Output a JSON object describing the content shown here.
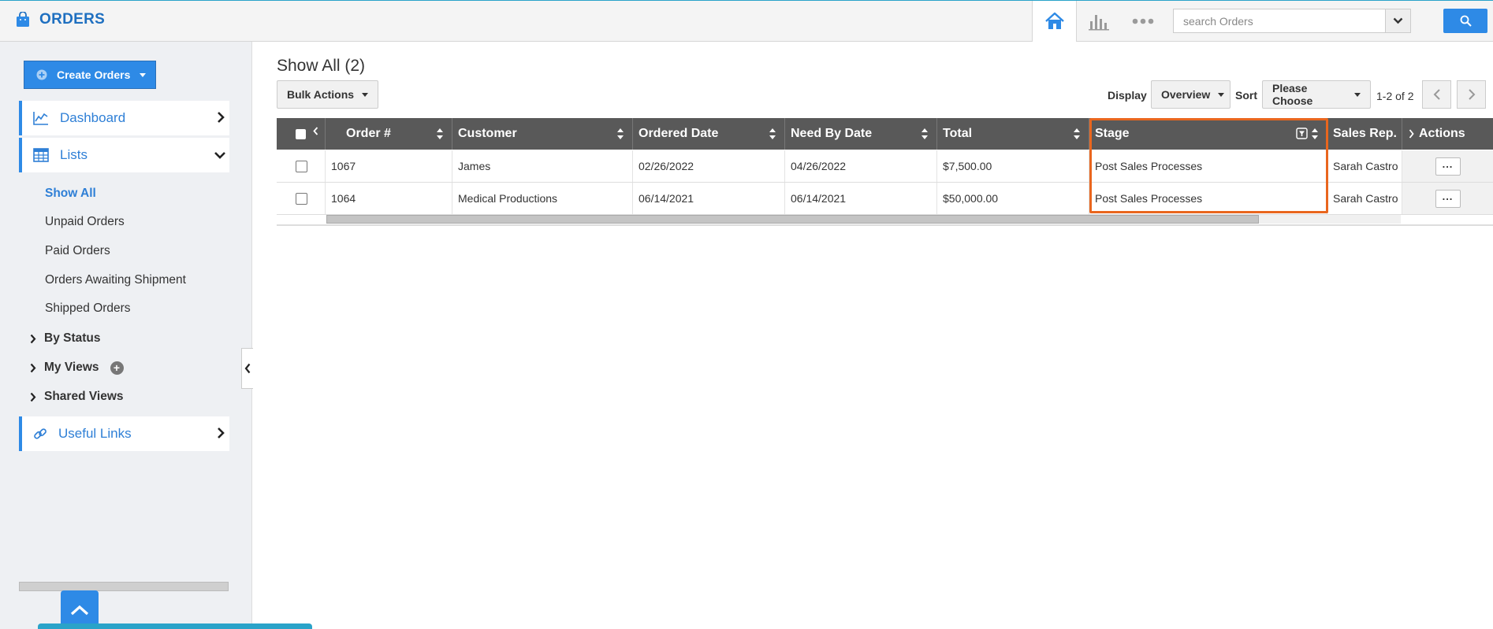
{
  "app": {
    "title": "ORDERS",
    "logo_icon": "shopping-bag-icon"
  },
  "topbar": {
    "icons": [
      "home-icon",
      "bar-chart-icon",
      "more-dots-icon"
    ],
    "search": {
      "placeholder": "search Orders",
      "value": ""
    },
    "search_icon": "magnifier-icon"
  },
  "sidebar": {
    "create_label": "Create Orders",
    "dashboard_label": "Dashboard",
    "lists_label": "Lists",
    "list_items": [
      "Show All",
      "Unpaid Orders",
      "Paid Orders",
      "Orders Awaiting Shipment",
      "Shipped Orders"
    ],
    "groups": [
      "By Status",
      "My Views",
      "Shared Views"
    ],
    "useful_links_label": "Useful Links"
  },
  "main": {
    "title": "Show All (2)",
    "bulk_actions_label": "Bulk Actions",
    "display_label": "Display",
    "display_value": "Overview",
    "sort_label": "Sort",
    "sort_value": "Please Choose",
    "pager_text": "1-2 of 2"
  },
  "table": {
    "columns": [
      "Order #",
      "Customer",
      "Ordered Date",
      "Need By Date",
      "Total",
      "Stage",
      "Sales Rep.",
      "Actions"
    ],
    "rows": [
      {
        "order": "1067",
        "customer": "James",
        "ordered_date": "02/26/2022",
        "need_by_date": "04/26/2022",
        "total": "$7,500.00",
        "stage": "Post Sales Processes",
        "sales_rep": "Sarah Castro",
        "menu": "..."
      },
      {
        "order": "1064",
        "customer": "Medical Productions",
        "ordered_date": "06/14/2021",
        "need_by_date": "06/14/2021",
        "total": "$50,000.00",
        "stage": "Post Sales Processes",
        "sales_rep": "Sarah Castro",
        "menu": "..."
      }
    ]
  },
  "colors": {
    "accent": "#2e8ae6",
    "header_bg": "#595959",
    "highlight": "#e9661e"
  }
}
